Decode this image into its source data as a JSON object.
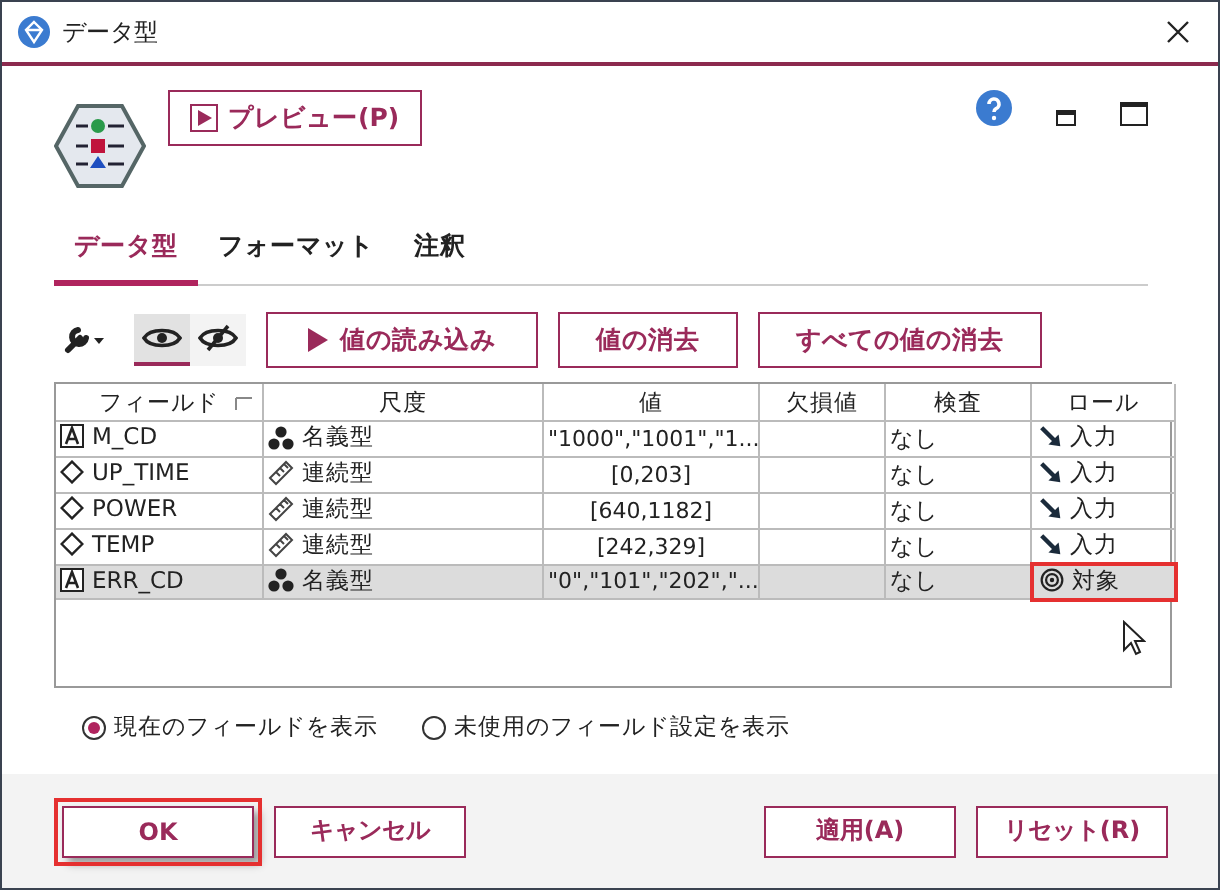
{
  "window": {
    "title": "データ型"
  },
  "preview_button": "プレビュー(P)",
  "tabs": [
    {
      "label": "データ型",
      "selected": true
    },
    {
      "label": "フォーマット",
      "selected": false
    },
    {
      "label": "注釈",
      "selected": false
    }
  ],
  "view_toggles": [
    {
      "kind": "show",
      "selected": true
    },
    {
      "kind": "hide",
      "selected": false
    }
  ],
  "actions": [
    "値の読み込み",
    "値の消去",
    "すべての値の消去"
  ],
  "table": {
    "columns": [
      "フィールド",
      "尺度",
      "値",
      "欠損値",
      "検査",
      "ロール"
    ],
    "rows": [
      {
        "field": {
          "name": "M_CD",
          "kind": "string"
        },
        "measure": {
          "label": "名義型",
          "kind": "nominal"
        },
        "values": "\"1000\",\"1001\",\"1...",
        "check": "なし",
        "role": {
          "label": "入力",
          "kind": "input"
        },
        "selected": false,
        "highlighted": false
      },
      {
        "field": {
          "name": "UP_TIME",
          "kind": "number"
        },
        "measure": {
          "label": "連続型",
          "kind": "continuous"
        },
        "values": "[0,203]",
        "check": "なし",
        "role": {
          "label": "入力",
          "kind": "input"
        },
        "selected": false,
        "highlighted": false
      },
      {
        "field": {
          "name": "POWER",
          "kind": "number"
        },
        "measure": {
          "label": "連続型",
          "kind": "continuous"
        },
        "values": "[640,1182]",
        "check": "なし",
        "role": {
          "label": "入力",
          "kind": "input"
        },
        "selected": false,
        "highlighted": false
      },
      {
        "field": {
          "name": "TEMP",
          "kind": "number"
        },
        "measure": {
          "label": "連続型",
          "kind": "continuous"
        },
        "values": "[242,329]",
        "check": "なし",
        "role": {
          "label": "入力",
          "kind": "input"
        },
        "selected": false,
        "highlighted": false
      },
      {
        "field": {
          "name": "ERR_CD",
          "kind": "string"
        },
        "measure": {
          "label": "名義型",
          "kind": "nominal"
        },
        "values": "\"0\",\"101\",\"202\",\"...",
        "check": "なし",
        "role": {
          "label": "対象",
          "kind": "target"
        },
        "selected": true,
        "highlighted": true
      }
    ]
  },
  "radios": [
    {
      "label": "現在のフィールドを表示",
      "selected": true
    },
    {
      "label": "未使用のフィールド設定を表示",
      "selected": false
    }
  ],
  "footer_buttons": [
    {
      "label": "OK",
      "highlighted": true
    },
    {
      "label": "キャンセル",
      "highlighted": false
    },
    {
      "label": "適用(A)",
      "highlighted": false
    },
    {
      "label": "リセット(R)",
      "highlighted": false
    }
  ]
}
